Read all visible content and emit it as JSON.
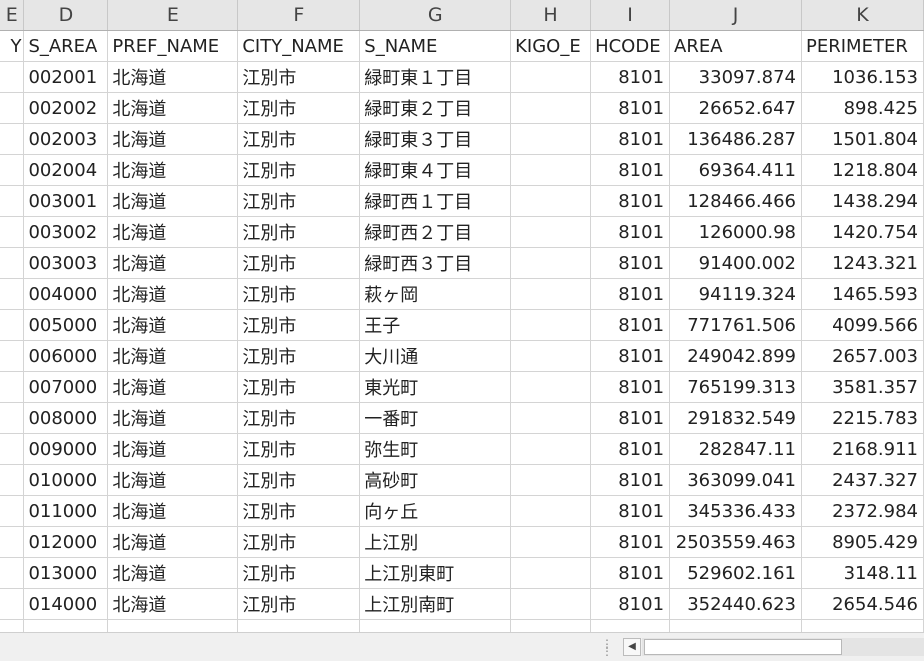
{
  "columns": [
    {
      "letter": "E",
      "header": "Y"
    },
    {
      "letter": "D",
      "header": "S_AREA"
    },
    {
      "letter": "E",
      "header": "PREF_NAME"
    },
    {
      "letter": "F",
      "header": "CITY_NAME"
    },
    {
      "letter": "G",
      "header": "S_NAME"
    },
    {
      "letter": "H",
      "header": "KIGO_E"
    },
    {
      "letter": "I",
      "header": "HCODE"
    },
    {
      "letter": "J",
      "header": "AREA"
    },
    {
      "letter": "K",
      "header": "PERIMETER"
    }
  ],
  "rows": [
    {
      "y": "",
      "s_area": "002001",
      "pref": "北海道",
      "city": "江別市",
      "s_name": "緑町東１丁目",
      "kigo": "",
      "hcode": "8101",
      "area": "33097.874",
      "perimeter": "1036.153"
    },
    {
      "y": "",
      "s_area": "002002",
      "pref": "北海道",
      "city": "江別市",
      "s_name": "緑町東２丁目",
      "kigo": "",
      "hcode": "8101",
      "area": "26652.647",
      "perimeter": "898.425"
    },
    {
      "y": "",
      "s_area": "002003",
      "pref": "北海道",
      "city": "江別市",
      "s_name": "緑町東３丁目",
      "kigo": "",
      "hcode": "8101",
      "area": "136486.287",
      "perimeter": "1501.804"
    },
    {
      "y": "",
      "s_area": "002004",
      "pref": "北海道",
      "city": "江別市",
      "s_name": "緑町東４丁目",
      "kigo": "",
      "hcode": "8101",
      "area": "69364.411",
      "perimeter": "1218.804"
    },
    {
      "y": "",
      "s_area": "003001",
      "pref": "北海道",
      "city": "江別市",
      "s_name": "緑町西１丁目",
      "kigo": "",
      "hcode": "8101",
      "area": "128466.466",
      "perimeter": "1438.294"
    },
    {
      "y": "",
      "s_area": "003002",
      "pref": "北海道",
      "city": "江別市",
      "s_name": "緑町西２丁目",
      "kigo": "",
      "hcode": "8101",
      "area": "126000.98",
      "perimeter": "1420.754"
    },
    {
      "y": "",
      "s_area": "003003",
      "pref": "北海道",
      "city": "江別市",
      "s_name": "緑町西３丁目",
      "kigo": "",
      "hcode": "8101",
      "area": "91400.002",
      "perimeter": "1243.321"
    },
    {
      "y": "",
      "s_area": "004000",
      "pref": "北海道",
      "city": "江別市",
      "s_name": "萩ヶ岡",
      "kigo": "",
      "hcode": "8101",
      "area": "94119.324",
      "perimeter": "1465.593"
    },
    {
      "y": "",
      "s_area": "005000",
      "pref": "北海道",
      "city": "江別市",
      "s_name": "王子",
      "kigo": "",
      "hcode": "8101",
      "area": "771761.506",
      "perimeter": "4099.566"
    },
    {
      "y": "",
      "s_area": "006000",
      "pref": "北海道",
      "city": "江別市",
      "s_name": "大川通",
      "kigo": "",
      "hcode": "8101",
      "area": "249042.899",
      "perimeter": "2657.003"
    },
    {
      "y": "",
      "s_area": "007000",
      "pref": "北海道",
      "city": "江別市",
      "s_name": "東光町",
      "kigo": "",
      "hcode": "8101",
      "area": "765199.313",
      "perimeter": "3581.357"
    },
    {
      "y": "",
      "s_area": "008000",
      "pref": "北海道",
      "city": "江別市",
      "s_name": "一番町",
      "kigo": "",
      "hcode": "8101",
      "area": "291832.549",
      "perimeter": "2215.783"
    },
    {
      "y": "",
      "s_area": "009000",
      "pref": "北海道",
      "city": "江別市",
      "s_name": "弥生町",
      "kigo": "",
      "hcode": "8101",
      "area": "282847.11",
      "perimeter": "2168.911"
    },
    {
      "y": "",
      "s_area": "010000",
      "pref": "北海道",
      "city": "江別市",
      "s_name": "高砂町",
      "kigo": "",
      "hcode": "8101",
      "area": "363099.041",
      "perimeter": "2437.327"
    },
    {
      "y": "",
      "s_area": "011000",
      "pref": "北海道",
      "city": "江別市",
      "s_name": "向ヶ丘",
      "kigo": "",
      "hcode": "8101",
      "area": "345336.433",
      "perimeter": "2372.984"
    },
    {
      "y": "",
      "s_area": "012000",
      "pref": "北海道",
      "city": "江別市",
      "s_name": "上江別",
      "kigo": "",
      "hcode": "8101",
      "area": "2503559.463",
      "perimeter": "8905.429"
    },
    {
      "y": "",
      "s_area": "013000",
      "pref": "北海道",
      "city": "江別市",
      "s_name": "上江別東町",
      "kigo": "",
      "hcode": "8101",
      "area": "529602.161",
      "perimeter": "3148.11"
    },
    {
      "y": "",
      "s_area": "014000",
      "pref": "北海道",
      "city": "江別市",
      "s_name": "上江別南町",
      "kigo": "",
      "hcode": "8101",
      "area": "352440.623",
      "perimeter": "2654.546"
    },
    {
      "y": "",
      "s_area": "",
      "pref": "",
      "city": "",
      "s_name": "",
      "kigo": "",
      "hcode": "",
      "area": "",
      "perimeter": ""
    }
  ],
  "scrollbar": {
    "left_arrow_icon": "triangle-left-icon",
    "split_icon": "vertical-dots-icon"
  },
  "colors": {
    "header_bg": "#e6e6e6",
    "grid": "#d4d4d4",
    "scroll_bg": "#f0f0f0"
  }
}
